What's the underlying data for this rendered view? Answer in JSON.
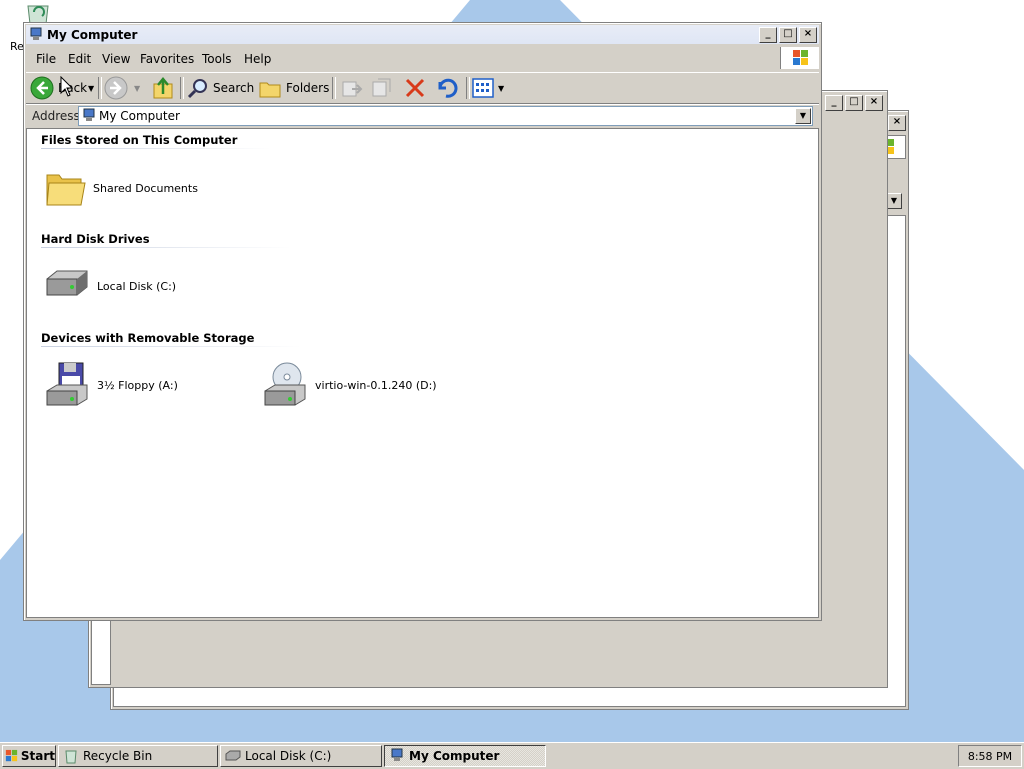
{
  "desktop": {
    "recycle_label_partial": "Re"
  },
  "main_window": {
    "title": "My Computer",
    "menu": [
      "File",
      "Edit",
      "View",
      "Favorites",
      "Tools",
      "Help"
    ],
    "toolbar": {
      "back": "Back",
      "search": "Search",
      "folders": "Folders"
    },
    "address": {
      "label": "Address",
      "value": "My Computer"
    },
    "groups": [
      {
        "title": "Files Stored on This Computer",
        "items": [
          {
            "label": "Shared Documents",
            "icon": "folder-icon"
          }
        ]
      },
      {
        "title": "Hard Disk Drives",
        "items": [
          {
            "label": "Local Disk (C:)",
            "icon": "hard-disk-icon"
          }
        ]
      },
      {
        "title": "Devices with Removable Storage",
        "items": [
          {
            "label": "3½ Floppy (A:)",
            "icon": "floppy-drive-icon"
          },
          {
            "label": "virtio-win-0.1.240 (D:)",
            "icon": "cd-drive-icon"
          }
        ]
      }
    ]
  },
  "taskbar": {
    "start": "Start",
    "tasks": [
      {
        "label": "Recycle Bin",
        "icon": "recycle-bin-icon",
        "active": false
      },
      {
        "label": "Local Disk (C:)",
        "icon": "hard-disk-icon",
        "active": false
      },
      {
        "label": "My Computer",
        "icon": "my-computer-icon",
        "active": true
      }
    ],
    "clock": "8:58 PM"
  },
  "colors": {
    "desktop_bg": "#ffffff",
    "desktop_shape": "#a8c8ea",
    "window_face": "#d4d0c8",
    "title_active": "#e0e8f6"
  }
}
